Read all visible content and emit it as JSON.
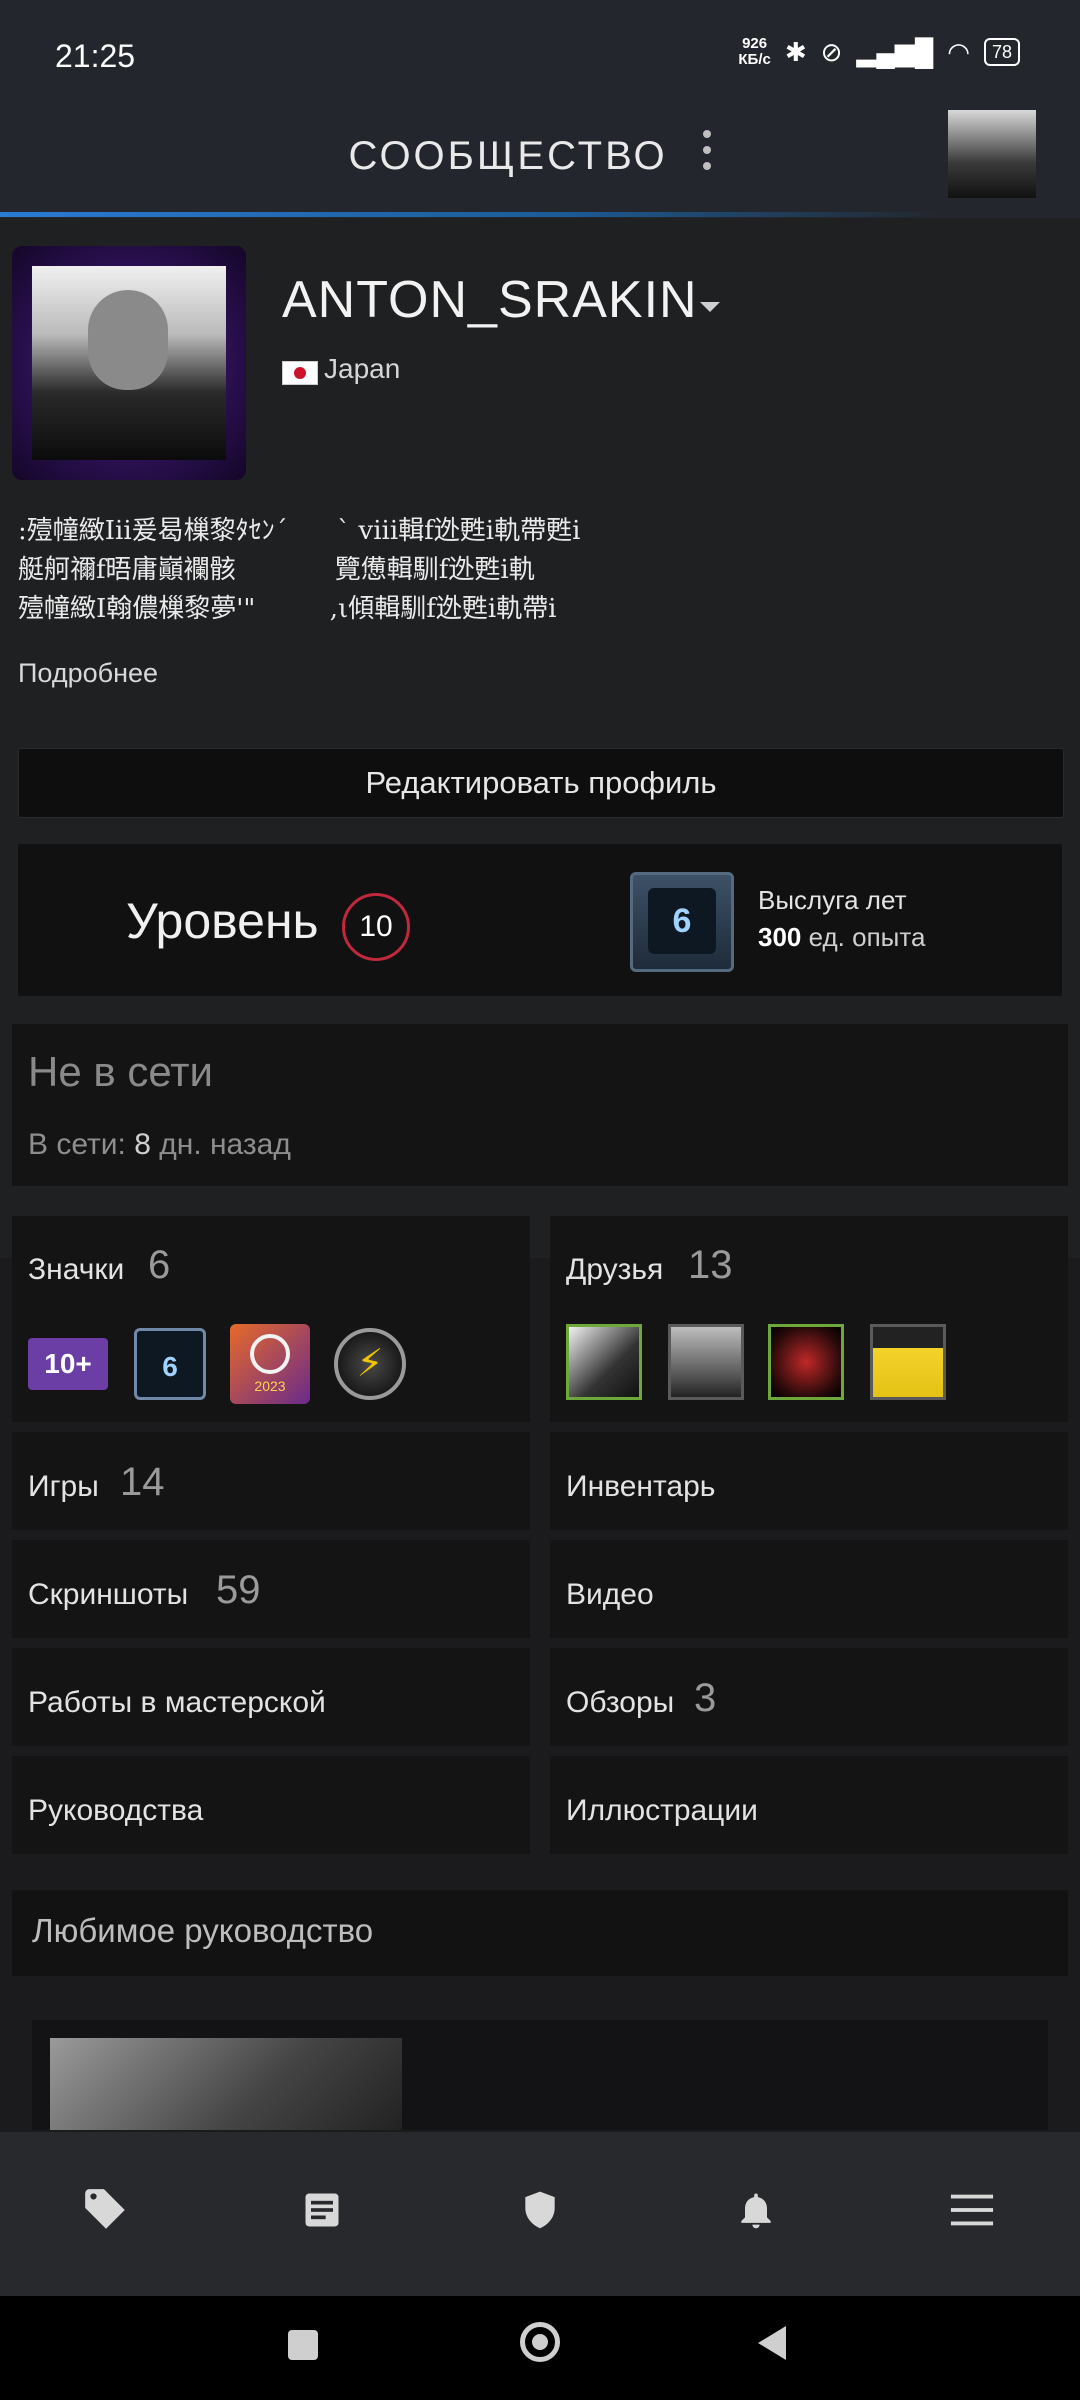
{
  "status_bar": {
    "time": "21:25",
    "net_speed_value": "926",
    "net_speed_unit": "КБ/с",
    "battery": "78",
    "icons": [
      "bluetooth-icon",
      "mute-icon",
      "signal-icon",
      "wifi-icon",
      "battery-icon"
    ]
  },
  "header": {
    "title": "СООБЩЕСТВО"
  },
  "profile": {
    "username": "ANTON_SRAKIN",
    "country": "Japan",
    "bio": ":殪幢緻Iii爰曷樔黎ﾀｾﾝ´      ` viii輯f迯甦i軌帶甦i\n艇舸禰f晤庸巓襴骸            覽憊輯馴f迯甦i軌\n殪幢緻I翰儂樔黎夢'\"         ,ι傾輯馴f迯甦i軌帶i",
    "more_link": "Подробнее",
    "edit_button": "Редактировать профиль"
  },
  "level": {
    "label": "Уровень",
    "value": "10",
    "badge_value": "6",
    "badge_title": "Выслуга лет",
    "xp_value": "300",
    "xp_unit": "ед. опыта"
  },
  "online": {
    "status": "Не в сети",
    "last_seen_label": "В сети:",
    "last_seen_value": "8",
    "last_seen_unit": "дн. назад"
  },
  "sections": {
    "badges": {
      "label": "Значки",
      "count": "6",
      "items": [
        "10+",
        "6",
        "2023"
      ]
    },
    "friends": {
      "label": "Друзья",
      "count": "13"
    },
    "games": {
      "label": "Игры",
      "count": "14"
    },
    "inventory": {
      "label": "Инвентарь"
    },
    "screenshots": {
      "label": "Скриншоты",
      "count": "59"
    },
    "videos": {
      "label": "Видео"
    },
    "workshop": {
      "label": "Работы в мастерской"
    },
    "reviews": {
      "label": "Обзоры",
      "count": "3"
    },
    "guides": {
      "label": "Руководства"
    },
    "artwork": {
      "label": "Иллюстрации"
    }
  },
  "favorite_guide": {
    "title": "Любимое руководство"
  },
  "bottom_nav": {
    "items": [
      "tag-icon",
      "news-icon",
      "shield-icon",
      "bell-icon",
      "menu-icon"
    ]
  }
}
